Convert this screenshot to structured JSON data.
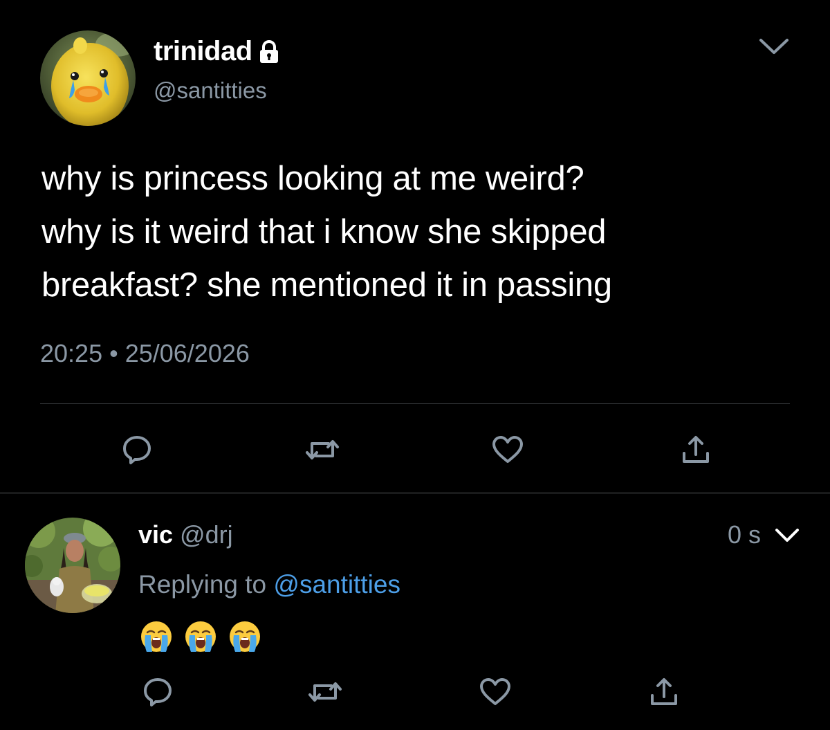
{
  "main_tweet": {
    "author_name": "trinidad",
    "author_handle": "@santitties",
    "text_lines": [
      "why is princess looking at me weird?",
      "why is it weird that i know she skipped",
      "breakfast? she mentioned it in passing"
    ],
    "time": "20:25",
    "separator": "•",
    "date": "25/06/2026"
  },
  "reply_tweet": {
    "author_name": "vic",
    "author_handle": "@drj",
    "time_ago": "0 s",
    "replying_prefix": "Replying to ",
    "replying_handle": "@santitties",
    "emojis": [
      "😭",
      "😭",
      "😭"
    ]
  },
  "icons": {
    "lock": "lock-icon",
    "caret": "chevron-down-icon",
    "reply": "reply-icon",
    "retweet": "retweet-icon",
    "like": "heart-icon",
    "share": "share-icon"
  },
  "colors": {
    "background": "#000000",
    "text": "#ffffff",
    "secondary": "#8b98a5",
    "link": "#4d9fe8",
    "divider": "#3a3d40"
  }
}
